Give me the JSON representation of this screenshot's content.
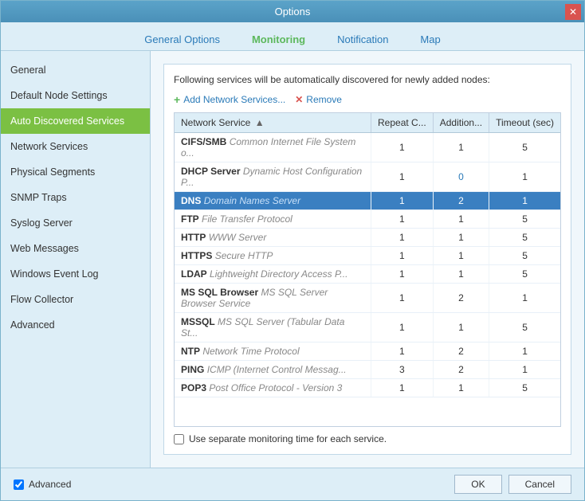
{
  "window": {
    "title": "Options"
  },
  "tabs": [
    {
      "id": "general-options",
      "label": "General Options",
      "active": false
    },
    {
      "id": "monitoring",
      "label": "Monitoring",
      "active": true
    },
    {
      "id": "notification",
      "label": "Notification",
      "active": false
    },
    {
      "id": "map",
      "label": "Map",
      "active": false
    }
  ],
  "sidebar": {
    "items": [
      {
        "id": "general",
        "label": "General",
        "active": false
      },
      {
        "id": "default-node-settings",
        "label": "Default Node Settings",
        "active": false
      },
      {
        "id": "auto-discovered-services",
        "label": "Auto Discovered Services",
        "active": true
      },
      {
        "id": "network-services",
        "label": "Network Services",
        "active": false
      },
      {
        "id": "physical-segments",
        "label": "Physical Segments",
        "active": false
      },
      {
        "id": "snmp-traps",
        "label": "SNMP Traps",
        "active": false
      },
      {
        "id": "syslog-server",
        "label": "Syslog Server",
        "active": false
      },
      {
        "id": "web-messages",
        "label": "Web Messages",
        "active": false
      },
      {
        "id": "windows-event-log",
        "label": "Windows Event Log",
        "active": false
      },
      {
        "id": "flow-collector",
        "label": "Flow Collector",
        "active": false
      },
      {
        "id": "advanced",
        "label": "Advanced",
        "active": false
      }
    ]
  },
  "main": {
    "description": "Following services will  be automatically discovered for newly added nodes:",
    "toolbar": {
      "add_label": "Add Network Services...",
      "remove_label": "Remove"
    },
    "table": {
      "columns": [
        {
          "id": "network-service",
          "label": "Network Service",
          "sortable": true
        },
        {
          "id": "repeat-count",
          "label": "Repeat C..."
        },
        {
          "id": "additional",
          "label": "Addition..."
        },
        {
          "id": "timeout",
          "label": "Timeout (sec)"
        }
      ],
      "rows": [
        {
          "name": "CIFS/SMB",
          "desc": "Common Internet File System o...",
          "repeat": "1",
          "additional": "1",
          "timeout": "5",
          "selected": false
        },
        {
          "name": "DHCP Server",
          "desc": "Dynamic Host Configuration P...",
          "repeat": "1",
          "additional": "0",
          "timeout": "1",
          "selected": false
        },
        {
          "name": "DNS",
          "desc": "Domain Names Server",
          "repeat": "1",
          "additional": "2",
          "timeout": "1",
          "selected": true
        },
        {
          "name": "FTP",
          "desc": "File Transfer Protocol",
          "repeat": "1",
          "additional": "1",
          "timeout": "5",
          "selected": false
        },
        {
          "name": "HTTP",
          "desc": "WWW Server",
          "repeat": "1",
          "additional": "1",
          "timeout": "5",
          "selected": false
        },
        {
          "name": "HTTPS",
          "desc": "Secure HTTP",
          "repeat": "1",
          "additional": "1",
          "timeout": "5",
          "selected": false
        },
        {
          "name": "LDAP",
          "desc": "Lightweight Directory Access P...",
          "repeat": "1",
          "additional": "1",
          "timeout": "5",
          "selected": false
        },
        {
          "name": "MS SQL Browser",
          "desc": "MS SQL Server Browser Service",
          "repeat": "1",
          "additional": "2",
          "timeout": "1",
          "selected": false
        },
        {
          "name": "MSSQL",
          "desc": "MS SQL Server (Tabular Data St...",
          "repeat": "1",
          "additional": "1",
          "timeout": "5",
          "selected": false
        },
        {
          "name": "NTP",
          "desc": "Network Time Protocol",
          "repeat": "1",
          "additional": "2",
          "timeout": "1",
          "selected": false
        },
        {
          "name": "PING",
          "desc": "ICMP (Internet Control Messag...",
          "repeat": "3",
          "additional": "2",
          "timeout": "1",
          "selected": false
        },
        {
          "name": "POP3",
          "desc": "Post Office Protocol - Version 3",
          "repeat": "1",
          "additional": "1",
          "timeout": "5",
          "selected": false
        }
      ]
    },
    "checkbox": {
      "label": "Use separate monitoring time for each service.",
      "checked": false
    }
  },
  "footer": {
    "advanced_label": "Advanced",
    "advanced_checked": true,
    "ok_label": "OK",
    "cancel_label": "Cancel"
  }
}
